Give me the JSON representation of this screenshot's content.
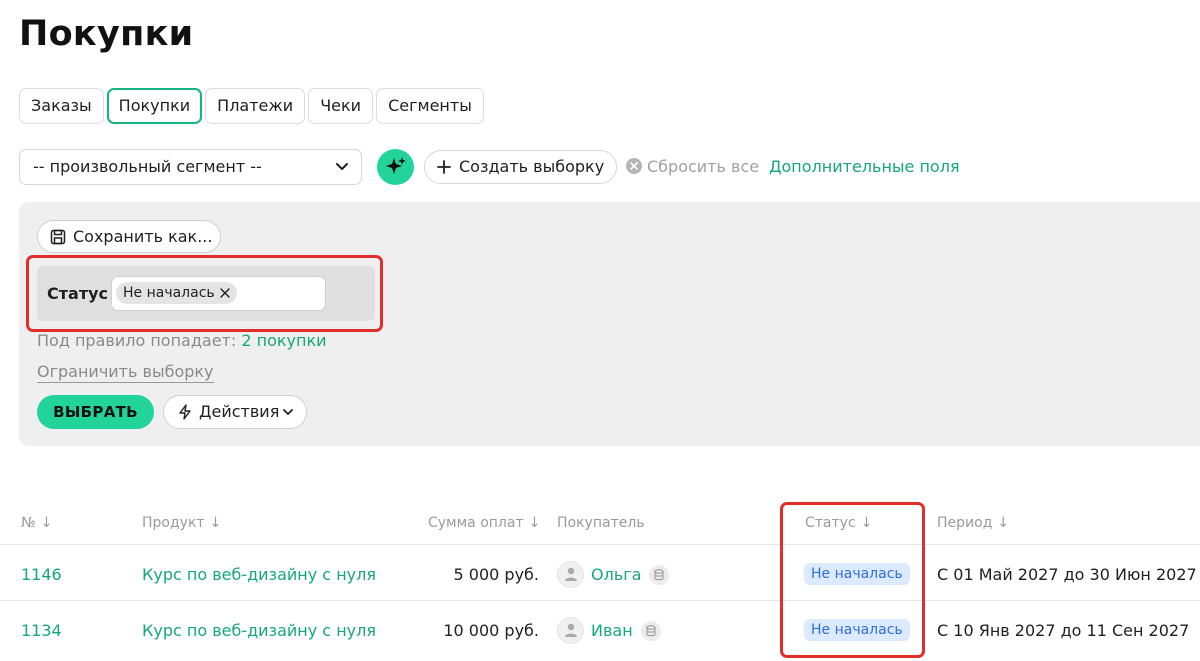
{
  "page": {
    "title": "Покупки"
  },
  "tabs": [
    {
      "label": "Заказы",
      "active": false
    },
    {
      "label": "Покупки",
      "active": true
    },
    {
      "label": "Платежи",
      "active": false
    },
    {
      "label": "Чеки",
      "active": false
    },
    {
      "label": "Сегменты",
      "active": false
    }
  ],
  "toolbar": {
    "segment_select_value": "-- произвольный сегмент --",
    "create_label": "Создать выборку",
    "reset_label": "Сбросить все",
    "extra_fields_label": "Дополнительные поля"
  },
  "filter": {
    "save_label": "Сохранить как...",
    "status_label": "Статус",
    "status_chip": "Не началась",
    "rule_prefix": "Под правило попадает:",
    "rule_count": "2 покупки",
    "limit_label": "Ограничить выборку",
    "choose_label": "ВЫБРАТЬ",
    "actions_label": "Действия"
  },
  "table": {
    "columns": {
      "number": "№",
      "product": "Продукт",
      "sum": "Сумма оплат",
      "buyer": "Покупатель",
      "status": "Статус",
      "period": "Период"
    },
    "sort_arrow": "↓",
    "rows": [
      {
        "number": "1146",
        "product": "Курс по веб-дизайну с нуля",
        "sum": "5 000 руб.",
        "buyer": "Ольга",
        "status": "Не началась",
        "period": "С 01 Май 2027 до 30 Июн 2027"
      },
      {
        "number": "1134",
        "product": "Курс по веб-дизайну с нуля",
        "sum": "10 000 руб.",
        "buyer": "Иван",
        "status": "Не началась",
        "period": "С 10 Янв 2027 до 11 Сен 2027"
      }
    ]
  },
  "colors": {
    "accent": "#22d39a",
    "link": "#16a874",
    "highlight": "#e22d2d",
    "badge_bg": "#dceaff",
    "badge_text": "#2f6fd6"
  },
  "icons": [
    "chevron-down-icon",
    "sparkle-icon",
    "plus-icon",
    "close-circle-icon",
    "save-icon",
    "close-icon",
    "bolt-icon",
    "user-icon",
    "database-icon"
  ]
}
